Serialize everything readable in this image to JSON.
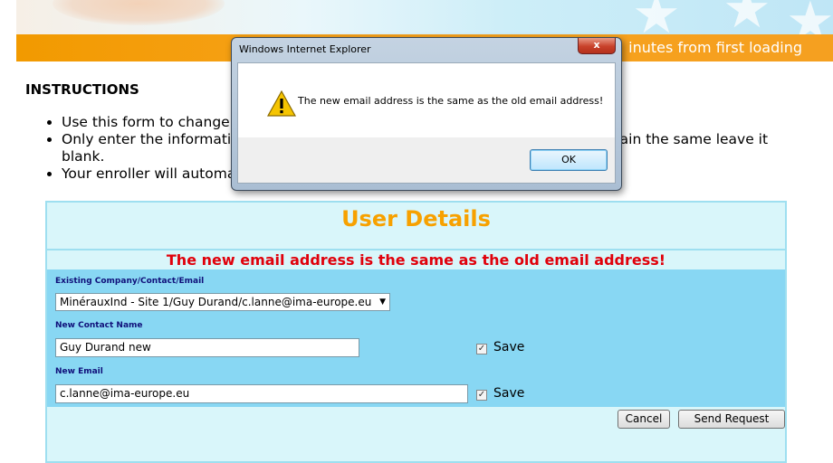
{
  "banner": {
    "timer_text": "inutes from first loading"
  },
  "instructions": {
    "heading": "INSTRUCTIONS",
    "items": [
      "Use this form to change yo",
      "Only enter the information",
      "blank.",
      "Your enroller will automati",
      "emain the same leave it"
    ]
  },
  "panel": {
    "title": "User Details",
    "error": "The new email address is the same as the old email address!",
    "existing_label": "Existing Company/Contact/Email",
    "existing_value": "MinérauxInd - Site 1/Guy Durand/c.lanne@ima-europe.eu",
    "contact_label": "New Contact Name",
    "contact_value": "Guy Durand new",
    "email_label": "New Email",
    "email_value": "c.lanne@ima-europe.eu",
    "save_label": "Save",
    "save_contact_checked": true,
    "save_email_checked": true,
    "cancel_label": "Cancel",
    "send_label": "Send Request"
  },
  "dialog": {
    "title": "Windows Internet Explorer",
    "close_label": "x",
    "message": "The new email address is the same as the old email address!",
    "ok_label": "OK",
    "icon": "warning-icon"
  },
  "colors": {
    "accent_orange": "#f7a100",
    "error_red": "#e0000b",
    "panel_bg": "#d9f6fa",
    "form_bg": "#88d7f3"
  }
}
